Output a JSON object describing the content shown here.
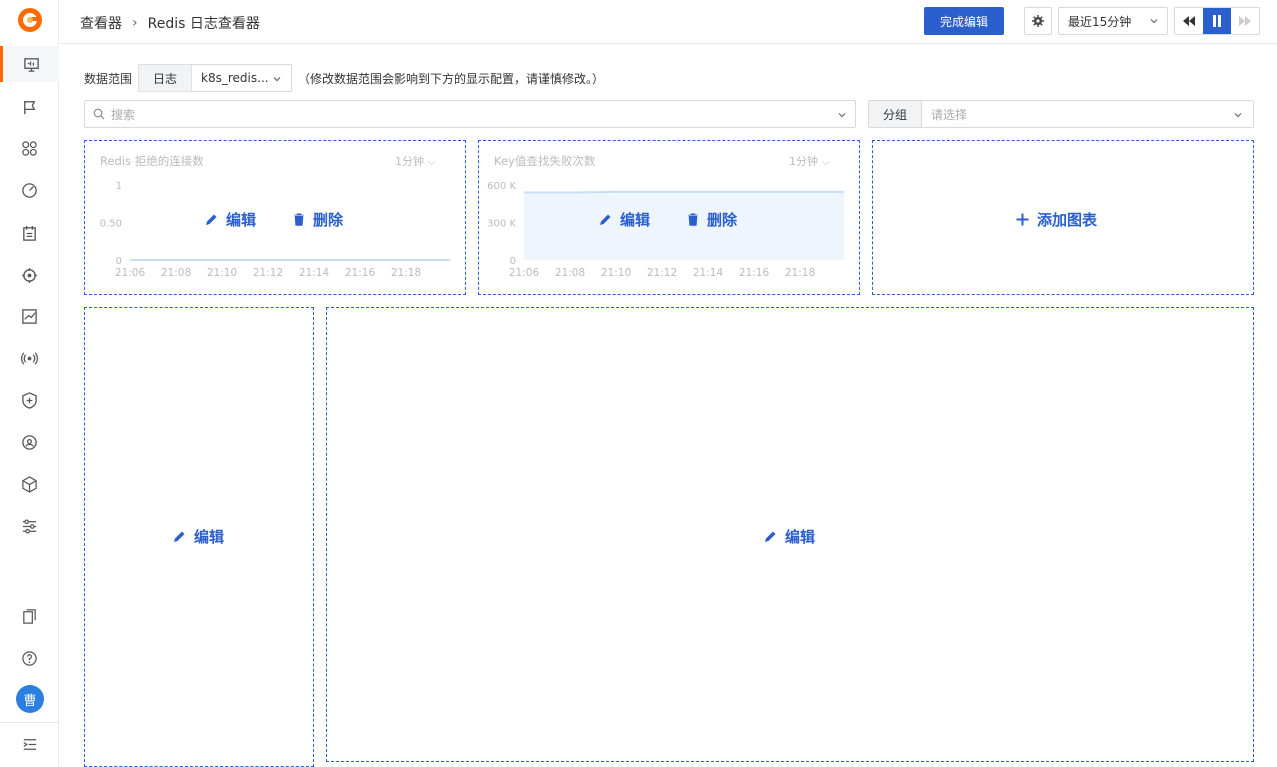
{
  "sidebar": {
    "avatar_text": "曹",
    "icons": [
      "monitor-icon",
      "flag-icon",
      "apps-icon",
      "gauge-icon",
      "calendar-icon",
      "target-icon",
      "chart-icon",
      "signal-icon",
      "shield-icon",
      "radar-icon",
      "cube-icon",
      "sliders-icon",
      "copy-icon",
      "help-icon",
      "collapse-icon"
    ]
  },
  "header": {
    "breadcrumb_root": "查看器",
    "breadcrumb_current": "Redis 日志查看器",
    "done_button": "完成编辑",
    "time_range": "最近15分钟"
  },
  "scope": {
    "label": "数据范围",
    "type": "日志",
    "value": "k8s_redis...",
    "note": "（修改数据范围会影响到下方的显示配置，请谨慎修改。）"
  },
  "search": {
    "placeholder": "搜索"
  },
  "group": {
    "label": "分组",
    "placeholder": "请选择"
  },
  "panels": [
    {
      "title": "Redis 拒绝的连接数",
      "interval": "1分钟",
      "edit": "编辑",
      "delete": "删除"
    },
    {
      "title": "Key值查找失败次数",
      "interval": "1分钟",
      "edit": "编辑",
      "delete": "删除"
    },
    {
      "add_label": "添加图表"
    },
    {
      "edit": "编辑"
    },
    {
      "edit": "编辑"
    }
  ],
  "chart_data": [
    {
      "type": "line",
      "title": "Redis 拒绝的连接数",
      "categories": [
        "21:06",
        "21:08",
        "21:10",
        "21:12",
        "21:14",
        "21:16",
        "21:18"
      ],
      "y_ticks": [
        "1",
        "0.50",
        "0"
      ],
      "ylim": [
        0,
        1
      ],
      "series": [
        {
          "values": [
            0,
            0,
            0,
            0,
            0,
            0,
            0
          ]
        }
      ]
    },
    {
      "type": "area",
      "title": "Key值查找失败次数",
      "categories": [
        "21:06",
        "21:08",
        "21:10",
        "21:12",
        "21:14",
        "21:16",
        "21:18"
      ],
      "y_ticks": [
        "600 K",
        "300 K",
        "0"
      ],
      "ylim": [
        0,
        600000
      ],
      "series": [
        {
          "values": [
            540000,
            540000,
            545000,
            545000,
            545000,
            545000,
            545000
          ]
        }
      ]
    }
  ]
}
